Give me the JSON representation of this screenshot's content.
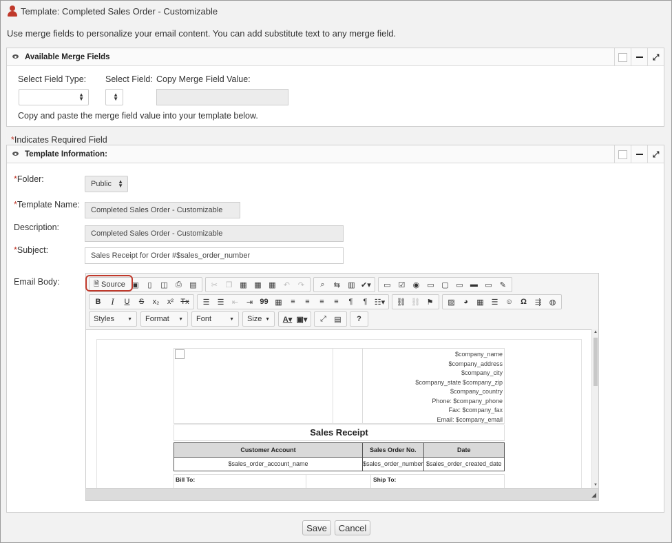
{
  "page": {
    "title": "Template: Completed Sales Order - Customizable",
    "intro": "Use merge fields to personalize your email content. You can add substitute text to any merge field."
  },
  "merge_panel": {
    "title": "Available Merge Fields",
    "field_type_label": "Select Field Type:",
    "field_label": "Select Field:",
    "copy_label": "Copy Merge Field Value:",
    "field_type_value": "",
    "field_value": "",
    "copy_value": "",
    "help": "Copy and paste the merge field value into your template below."
  },
  "required_note": "Indicates Required Field",
  "template_panel": {
    "title": "Template Information:",
    "folder_label": "Folder:",
    "folder_value": "Public",
    "name_label": "Template Name:",
    "name_value": "Completed Sales Order - Customizable",
    "desc_label": "Description:",
    "desc_value": "Completed Sales Order - Customizable",
    "subject_label": "Subject:",
    "subject_value": "Sales Receipt for Order #$sales_order_number",
    "body_label": "Email Body:"
  },
  "editor": {
    "source_label": "Source",
    "styles_label": "Styles",
    "format_label": "Format",
    "font_label": "Font",
    "size_label": "Size",
    "bold": "B",
    "italic": "I",
    "underline": "U",
    "strike": "S",
    "subscript": "x₂",
    "superscript": "x²",
    "clear_format": "Tx",
    "blockquote": "99",
    "special_char": "Ω",
    "help": "?"
  },
  "document": {
    "company_lines": [
      "$company_name",
      "$company_address",
      "$company_city",
      "$company_state $company_zip",
      "$company_country",
      "Phone: $company_phone",
      "Fax: $company_fax",
      "Email: $company_email"
    ],
    "title": "Sales Receipt",
    "columns": [
      "Customer Account",
      "Sales Order No.",
      "Date"
    ],
    "row": [
      "$sales_order_account_name",
      "$sales_order_number",
      "$sales_order_created_date"
    ],
    "bill_to": "Bill To:",
    "ship_to": "Ship To:"
  },
  "actions": {
    "save": "Save",
    "cancel": "Cancel"
  }
}
